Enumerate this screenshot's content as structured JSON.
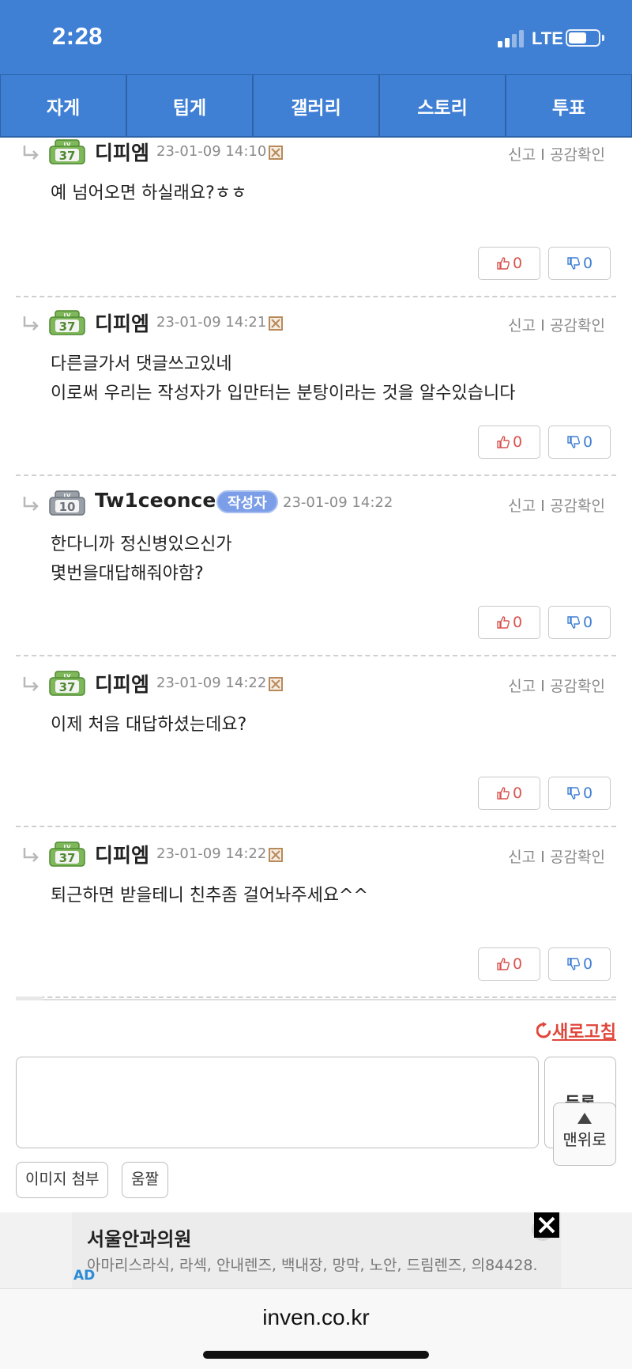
{
  "status": {
    "time": "2:28",
    "network": "LTE"
  },
  "tabs": [
    "자게",
    "팁게",
    "갤러리",
    "스토리",
    "투표"
  ],
  "meta": {
    "report": "신고",
    "likes": "공감확인"
  },
  "comments": [
    {
      "level": "37",
      "nick": "디피엠",
      "date": "23-01-09 14:10",
      "author": false,
      "lines": [
        "예 넘어오면 하실래요?ㅎㅎ"
      ],
      "up": "0",
      "down": "0"
    },
    {
      "level": "37",
      "nick": "디피엠",
      "date": "23-01-09 14:21",
      "author": false,
      "lines": [
        "다른글가서 댓글쓰고있네",
        "이로써 우리는 작성자가 입만터는 분탕이라는 것을 알수있습니다"
      ],
      "up": "0",
      "down": "0"
    },
    {
      "level": "10",
      "nick": "Tw1ceonce",
      "badge": "작성자",
      "date": "23-01-09 14:22",
      "author": true,
      "lines": [
        "한다니까 정신병있으신가",
        "몇번을대답해줘야함?"
      ],
      "up": "0",
      "down": "0"
    },
    {
      "level": "37",
      "nick": "디피엠",
      "date": "23-01-09 14:22",
      "author": false,
      "lines": [
        "이제 처음 대답하셨는데요?"
      ],
      "up": "0",
      "down": "0"
    },
    {
      "level": "37",
      "nick": "디피엠",
      "date": "23-01-09 14:22",
      "author": false,
      "lines": [
        "퇴근하면 받을테니 친추좀 걸어놔주세요^^"
      ],
      "up": "0",
      "down": "0"
    }
  ],
  "actions": {
    "refresh": "새로고침",
    "submit": "등록",
    "to_top": "맨위로",
    "attach_image": "이미지 첨부",
    "emoticon": "움짤"
  },
  "ad": {
    "title": "서울안과의원",
    "desc": "아마리스라식, 라섹, 안내렌즈, 백내장, 망막, 노안, 드림렌즈, 의84428.",
    "label": "AD"
  },
  "browser": {
    "url": "inven.co.kr"
  }
}
